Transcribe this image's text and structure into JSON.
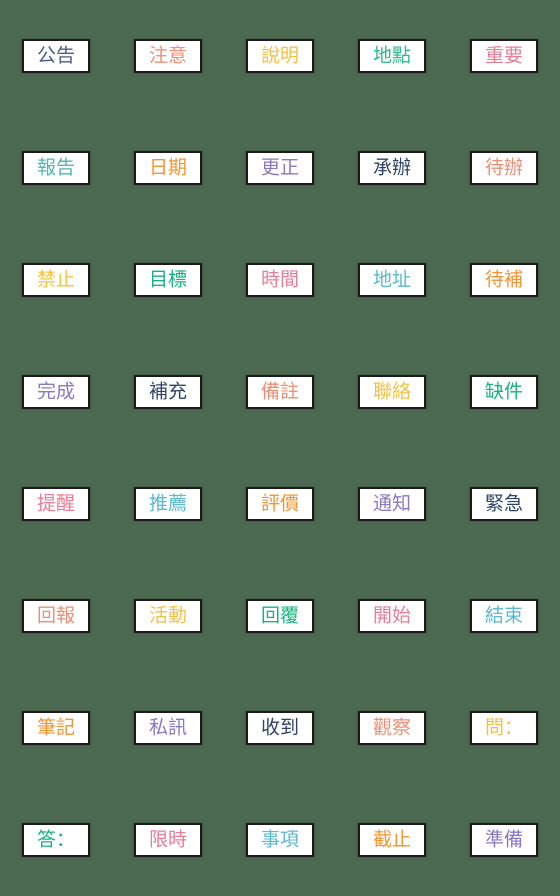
{
  "sheet": {
    "background_color": "#4b6851",
    "sticker_background": "#ffffff",
    "sticker_border_color": "#1d1b1a",
    "columns": 5,
    "rows": 8,
    "total_stickers": 40
  },
  "palette": {
    "blue": "#4a5d87",
    "salmon": "#ec8f77",
    "gold": "#f5c144",
    "teal": "#2fb98a",
    "pink": "#e87d95",
    "teal_light": "#53b5b0",
    "orange": "#f59331",
    "purple": "#8779c4",
    "navy": "#2f4468",
    "green": "#17b37e",
    "cyan": "#5bb9cf",
    "rose": "#e27c93"
  },
  "stickers": [
    {
      "text": "公告",
      "color": "#4a5d87",
      "row": 1,
      "col": 1
    },
    {
      "text": "注意",
      "color": "#ec8f77",
      "row": 1,
      "col": 2
    },
    {
      "text": "說明",
      "color": "#f5c144",
      "row": 1,
      "col": 3
    },
    {
      "text": "地點",
      "color": "#2fb98a",
      "row": 1,
      "col": 4
    },
    {
      "text": "重要",
      "color": "#e87d95",
      "row": 1,
      "col": 5
    },
    {
      "text": "報告",
      "color": "#53b5b0",
      "row": 2,
      "col": 1
    },
    {
      "text": "日期",
      "color": "#f59331",
      "row": 2,
      "col": 2
    },
    {
      "text": "更正",
      "color": "#8779c4",
      "row": 2,
      "col": 3
    },
    {
      "text": "承辦",
      "color": "#2f4468",
      "row": 2,
      "col": 4
    },
    {
      "text": "待辦",
      "color": "#ec8f77",
      "row": 2,
      "col": 5
    },
    {
      "text": "禁止",
      "color": "#f5c144",
      "row": 3,
      "col": 1
    },
    {
      "text": "目標",
      "color": "#17b37e",
      "row": 3,
      "col": 2
    },
    {
      "text": "時間",
      "color": "#e87d95",
      "row": 3,
      "col": 3
    },
    {
      "text": "地址",
      "color": "#5bb9cf",
      "row": 3,
      "col": 4
    },
    {
      "text": "待補",
      "color": "#f59331",
      "row": 3,
      "col": 5
    },
    {
      "text": "完成",
      "color": "#8779c4",
      "row": 4,
      "col": 1
    },
    {
      "text": "補充",
      "color": "#2f4468",
      "row": 4,
      "col": 2
    },
    {
      "text": "備註",
      "color": "#ec8f77",
      "row": 4,
      "col": 3
    },
    {
      "text": "聯絡",
      "color": "#f5c144",
      "row": 4,
      "col": 4
    },
    {
      "text": "缺件",
      "color": "#17b37e",
      "row": 4,
      "col": 5
    },
    {
      "text": "提醒",
      "color": "#e87d95",
      "row": 5,
      "col": 1
    },
    {
      "text": "推薦",
      "color": "#5bb9cf",
      "row": 5,
      "col": 2
    },
    {
      "text": "評價",
      "color": "#f59331",
      "row": 5,
      "col": 3
    },
    {
      "text": "通知",
      "color": "#8779c4",
      "row": 5,
      "col": 4
    },
    {
      "text": "緊急",
      "color": "#2f4468",
      "row": 5,
      "col": 5
    },
    {
      "text": "回報",
      "color": "#ec8f77",
      "row": 6,
      "col": 1
    },
    {
      "text": "活動",
      "color": "#f5c144",
      "row": 6,
      "col": 2
    },
    {
      "text": "回覆",
      "color": "#17b37e",
      "row": 6,
      "col": 3
    },
    {
      "text": "開始",
      "color": "#e87d95",
      "row": 6,
      "col": 4
    },
    {
      "text": "結束",
      "color": "#5bb9cf",
      "row": 6,
      "col": 5
    },
    {
      "text": "筆記",
      "color": "#f59331",
      "row": 7,
      "col": 1
    },
    {
      "text": "私訊",
      "color": "#8779c4",
      "row": 7,
      "col": 2
    },
    {
      "text": "收到",
      "color": "#2f4468",
      "row": 7,
      "col": 3
    },
    {
      "text": "觀察",
      "color": "#ec8f77",
      "row": 7,
      "col": 4
    },
    {
      "text": "問：",
      "color": "#f5c144",
      "row": 7,
      "col": 5
    },
    {
      "text": "答：",
      "color": "#17b37e",
      "row": 8,
      "col": 1
    },
    {
      "text": "限時",
      "color": "#e87d95",
      "row": 8,
      "col": 2
    },
    {
      "text": "事項",
      "color": "#5bb9cf",
      "row": 8,
      "col": 3
    },
    {
      "text": "截止",
      "color": "#f59331",
      "row": 8,
      "col": 4
    },
    {
      "text": "準備",
      "color": "#8779c4",
      "row": 8,
      "col": 5
    }
  ]
}
